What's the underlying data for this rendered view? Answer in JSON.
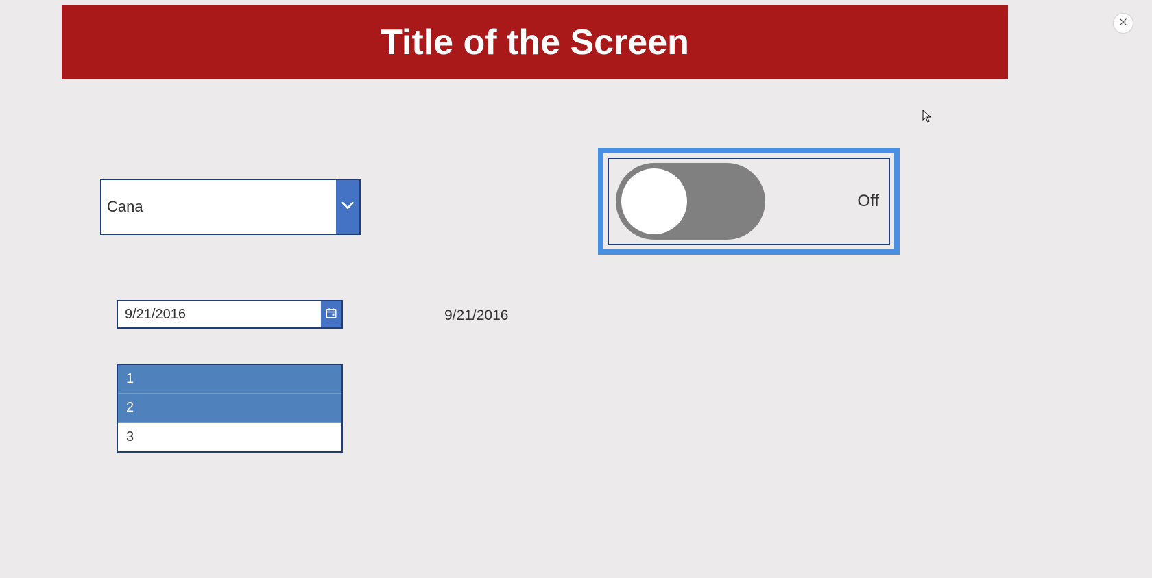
{
  "header": {
    "title": "Title of the Screen"
  },
  "combo": {
    "value": "Cana"
  },
  "datepicker": {
    "value": "9/21/2016"
  },
  "date_display": "9/21/2016",
  "listbox": {
    "items": [
      {
        "label": "1",
        "selected": true
      },
      {
        "label": "2",
        "selected": true
      },
      {
        "label": "3",
        "selected": false
      }
    ]
  },
  "toggle": {
    "state_label": "Off",
    "on": false,
    "focused": true
  }
}
